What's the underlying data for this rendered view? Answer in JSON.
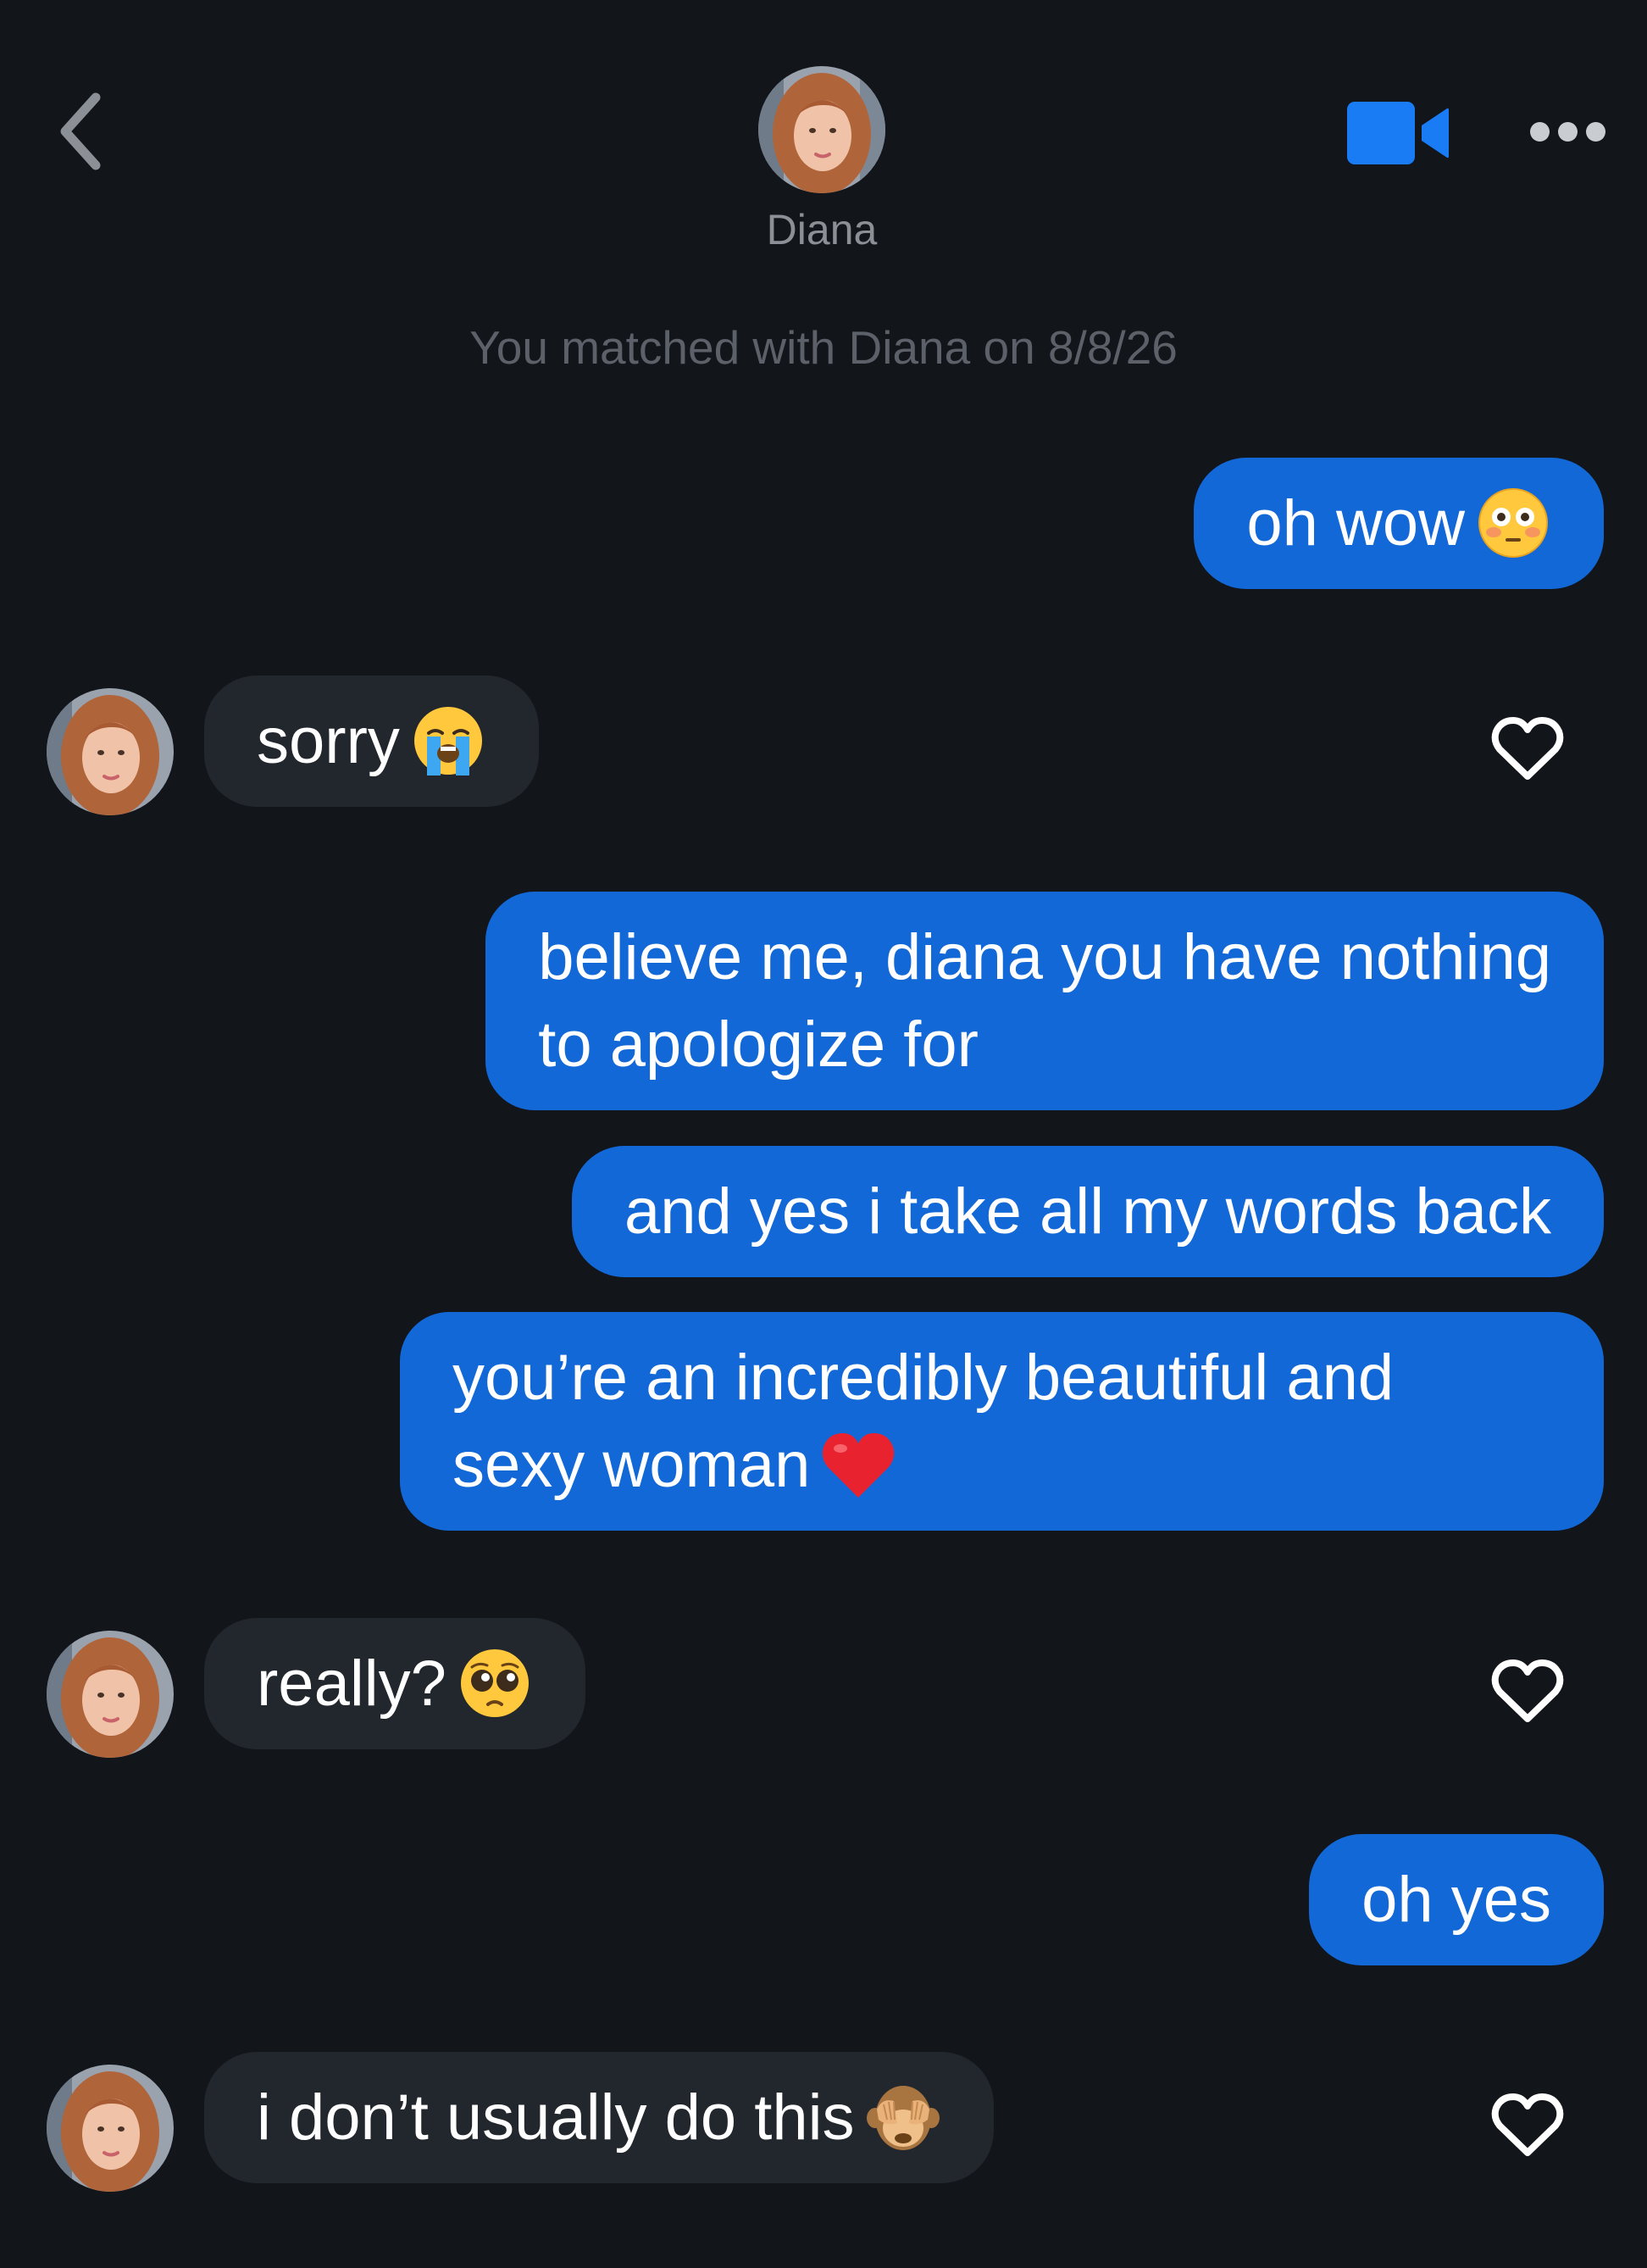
{
  "header": {
    "contact_name": "Diana",
    "match_note": "You matched with Diana on 8/8/26"
  },
  "messages": [
    {
      "direction": "sent",
      "text": "oh wow",
      "emoji": "flushed-face"
    },
    {
      "direction": "received",
      "text": "sorry",
      "emoji": "loudly-crying-face"
    },
    {
      "direction": "sent",
      "lines": [
        "believe me, diana you have nothing",
        "to apologize for"
      ]
    },
    {
      "direction": "sent",
      "text": "and yes i take all my words back"
    },
    {
      "direction": "sent",
      "lines": [
        "you’re an incredibly beautiful and",
        "sexy woman"
      ],
      "emoji": "red-heart"
    },
    {
      "direction": "received",
      "text": "really?",
      "emoji": "pleading-face"
    },
    {
      "direction": "sent",
      "text": "oh yes"
    },
    {
      "direction": "received",
      "text": "i don’t usually do this",
      "emoji": "see-no-evil-monkey"
    }
  ],
  "icons": {
    "back": "chevron-left-icon",
    "video": "video-camera-icon",
    "more": "more-dots-icon",
    "like": "heart-outline-icon"
  },
  "colors": {
    "background": "#12151a",
    "sent_bubble": "#1268d6",
    "received_bubble": "#22262d",
    "accent": "#1a7cf5"
  }
}
